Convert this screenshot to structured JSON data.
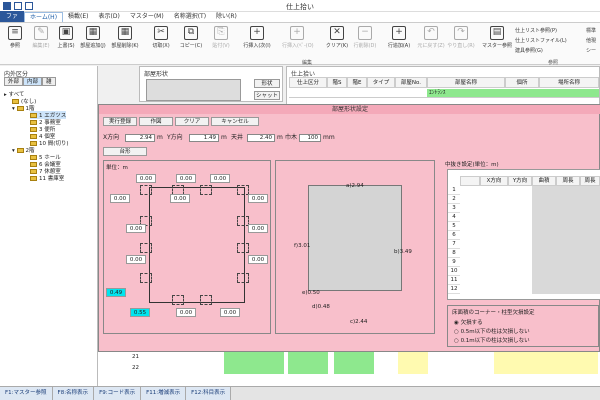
{
  "window": {
    "title": "仕上拾い"
  },
  "menu": {
    "file": "ファ",
    "items": [
      "ホーム(H)",
      "積載(E)",
      "表示(D)",
      "マスター(M)",
      "名称選択(T)",
      "除い(R)"
    ]
  },
  "ribbon": {
    "buttons": [
      {
        "label": "参照",
        "icon": "≡"
      },
      {
        "label": "編集(E)",
        "icon": "✎"
      },
      {
        "label": "上書(S)",
        "icon": "▣"
      },
      {
        "label": "部屋追加(J)",
        "icon": "▦"
      },
      {
        "label": "部屋削除(K)",
        "icon": "▦"
      },
      {
        "label": "切取(X)",
        "icon": "✂"
      },
      {
        "label": "コピー(C)",
        "icon": "⧉"
      },
      {
        "label": "貼付(V)",
        "icon": "⎘"
      },
      {
        "label": "行挿入(次(I)",
        "icon": "+"
      },
      {
        "label": "行挿入(ﾍﾟ-(O)",
        "icon": "+"
      },
      {
        "label": "クリア(K)",
        "icon": "✕"
      },
      {
        "label": "行削除(D)",
        "icon": "−"
      },
      {
        "label": "行追加(A)",
        "icon": "+"
      },
      {
        "label": "元に戻す(Z)",
        "icon": "↶"
      },
      {
        "label": "やり直し(R)",
        "icon": "↷"
      },
      {
        "label": "マスター参照",
        "icon": "▤"
      }
    ],
    "group_edit": "編集",
    "group_ref": "参照",
    "right_list": [
      "仕上リスト参照(P)",
      "仕上リストファイル(L)",
      "建具参照(G)"
    ],
    "right_list2": [
      "標準",
      "他現",
      "シー"
    ]
  },
  "left": {
    "title": "内外区分",
    "tabs": [
      "外部",
      "内部",
      "雑"
    ],
    "tree": [
      "すべて",
      "(なし)",
      "1階",
      "1 エガツス",
      "2 事務室",
      "3 便所",
      "4 個室",
      "10 間(切り)",
      "2階",
      "5 ホール",
      "6 会議室",
      "7 休憩室",
      "11 書庫室"
    ]
  },
  "mid": {
    "title": "部屋形状",
    "side_labels": [
      "形状",
      "シャット"
    ]
  },
  "right": {
    "title": "仕上拾い",
    "headers": [
      "仕上区分",
      "階S",
      "階E",
      "タイプ",
      "部屋No.",
      "部屋名称",
      "個所",
      "場所名称"
    ],
    "first_row_name": "ｴﾝﾄﾗﾝｽ"
  },
  "dialog": {
    "title": "部屋形状設定",
    "buttons": {
      "execute": "実行登録",
      "draw": "作図",
      "clear": "クリア",
      "cancel": "キャンセル",
      "base": "台形"
    },
    "x_label": "X方向",
    "x_value": "2.94",
    "y_label": "Y方向",
    "y_value": "1.49",
    "ceil_label": "天井",
    "ceil_value": "2.40",
    "wall_label": "巾木",
    "wall_value": "100",
    "unit_mm": "m",
    "unit_mm2": "mm",
    "shape_unit": "単位：m",
    "walls": {
      "top": "0.00",
      "top_in": "0.00",
      "top_right": "0.00",
      "left_top": "0.00",
      "left_in": "0.00",
      "right_top": "0.00",
      "left_mid": "0.00",
      "mid": "0.00",
      "right_mid": "0.00",
      "left_low": "0.00",
      "right_low": "0.00",
      "left_bottom": "0.49",
      "bottom_in": "0.00",
      "bottom_right": "0.00",
      "bottom_left_in": "0.55"
    },
    "preview": {
      "a": "a)2.94",
      "b": "b)3.49",
      "c": "c)2.44",
      "d": "d)0.48",
      "e": "e)0.50",
      "f": "f)3.01"
    },
    "hollow_title": "中抜き設定(単位：m)",
    "hollow_headers": [
      "X方向",
      "Y方向",
      "曲積",
      "周長",
      "周長"
    ],
    "hollow_rows": [
      "1",
      "2",
      "3",
      "4",
      "5",
      "6",
      "7",
      "8",
      "9",
      "10",
      "11",
      "12"
    ],
    "corner_title": "床面積のコーナー・柱型欠損設定",
    "corner_options": [
      "欠損する",
      "0.5m以下の柱は欠損しない",
      "0.1m以下の柱は欠損しない"
    ]
  },
  "bottom_rows": [
    "21",
    "22"
  ],
  "status": [
    "F1:マスター参照",
    "F8:名称表示",
    "F9:コード表示",
    "F11:増減表示",
    "F12:科目表示"
  ]
}
